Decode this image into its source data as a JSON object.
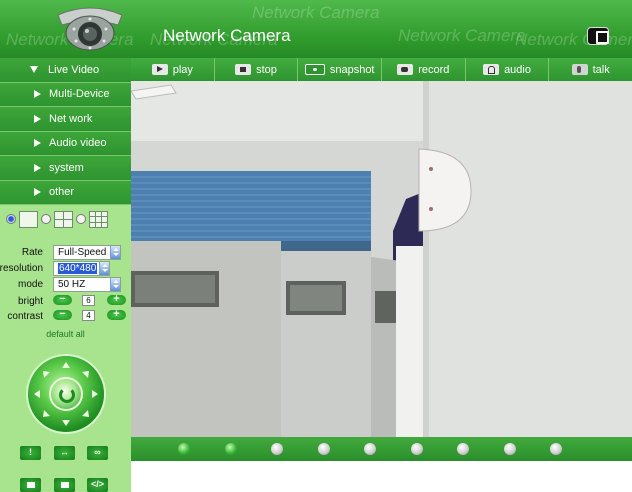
{
  "header": {
    "title": "Network Camera",
    "watermark": "Network Camera"
  },
  "sidebar": {
    "menu": [
      {
        "label": "Live Video",
        "active": true
      },
      {
        "label": "Multi-Device",
        "active": false
      },
      {
        "label": "Net work",
        "active": false
      },
      {
        "label": "Audio video",
        "active": false
      },
      {
        "label": "system",
        "active": false
      },
      {
        "label": "other",
        "active": false
      }
    ],
    "layout_options": [
      "single-view",
      "quad-view",
      "nine-view"
    ],
    "layout_selected": "single-view",
    "settings": {
      "rate": {
        "label": "Rate",
        "value": "Full-Speed"
      },
      "resolution": {
        "label": "resolution",
        "value": "640*480"
      },
      "mode": {
        "label": "mode",
        "value": "50 HZ"
      },
      "bright": {
        "label": "bright",
        "value": "6"
      },
      "contrast": {
        "label": "contrast",
        "value": "4"
      },
      "minus": "−",
      "plus": "+",
      "default_all": "default all"
    },
    "extra_buttons": [
      "!",
      "↔",
      "∞",
      "",
      "",
      "</>"
    ]
  },
  "toolbar": {
    "buttons": [
      {
        "label": "play",
        "icon": "play-icon"
      },
      {
        "label": "stop",
        "icon": "stop-icon"
      },
      {
        "label": "snapshot",
        "icon": "snapshot-icon"
      },
      {
        "label": "record",
        "icon": "record-icon"
      },
      {
        "label": "audio",
        "icon": "audio-icon"
      },
      {
        "label": "talk",
        "icon": "talk-icon"
      }
    ]
  },
  "preset_strip": {
    "dots": [
      true,
      true,
      false,
      false,
      false,
      false,
      false,
      false,
      false
    ]
  },
  "colors": {
    "brand_green": "#2e9430",
    "sidebar_bg": "#a8e38e"
  }
}
